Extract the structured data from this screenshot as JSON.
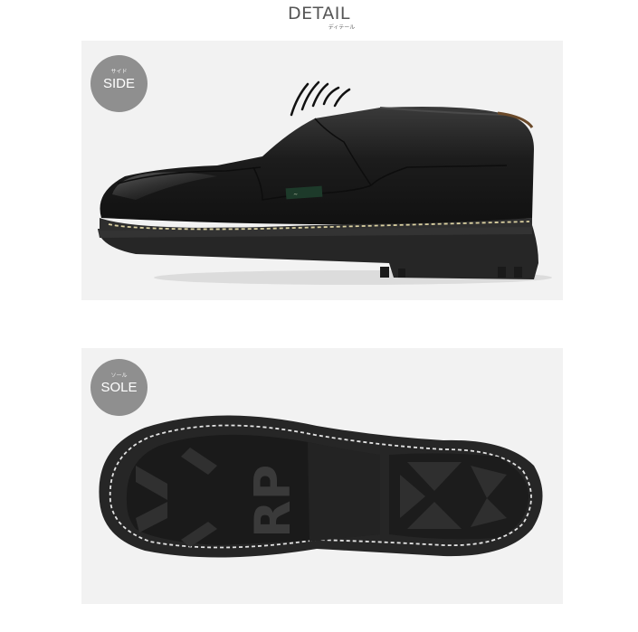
{
  "header": {
    "title": "DETAIL",
    "subtitle": "ディテール"
  },
  "panels": [
    {
      "badge_ruby": "サイド",
      "badge_label": "SIDE"
    },
    {
      "badge_ruby": "ソール",
      "badge_label": "SOLE"
    }
  ],
  "colors": {
    "panel_background": "#f2f2f2",
    "badge_background": "#8f8f8f",
    "shoe_leather": "#1e1e1e",
    "sole": "#2a2a2a",
    "stitching": "#d9cfa0",
    "heading_text": "#555555"
  }
}
